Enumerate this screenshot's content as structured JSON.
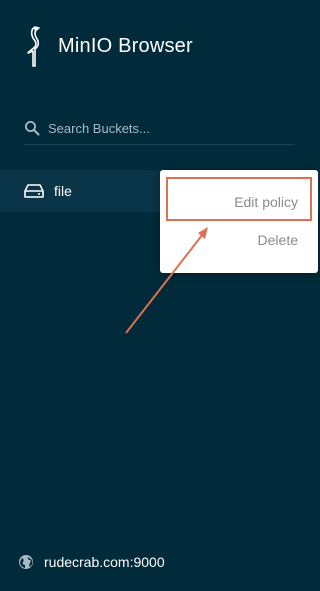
{
  "brand": {
    "title": "MinIO Browser",
    "logo_icon": "minio-bird-logo"
  },
  "search": {
    "placeholder": "Search Buckets...",
    "icon": "search-icon"
  },
  "buckets": [
    {
      "label": "file",
      "icon": "drive-icon"
    }
  ],
  "context_menu": {
    "items": [
      {
        "label": "Edit policy"
      },
      {
        "label": "Delete"
      }
    ]
  },
  "footer": {
    "host": "rudecrab.com:9000",
    "icon": "globe-icon"
  },
  "colors": {
    "sidebar_bg": "#012b3b",
    "annotation": "#d97250",
    "menu_text": "#8b8b8b"
  }
}
